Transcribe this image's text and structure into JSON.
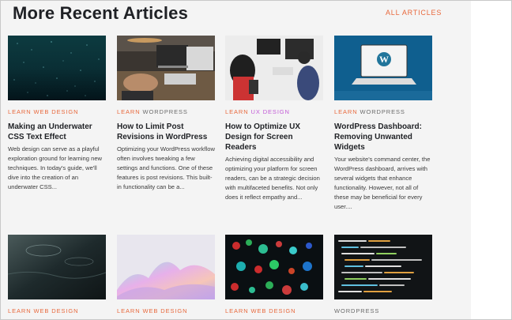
{
  "header": {
    "title": "More Recent Articles",
    "all_articles": "ALL ARTICLES"
  },
  "articles": [
    {
      "learn": "LEARN",
      "category": "WEB DESIGN",
      "title": "Making an Underwater CSS Text Effect",
      "excerpt": "Web design can serve as a playful exploration ground for learning new techniques. In today's guide, we'll dive into the creation of an underwater CSS..."
    },
    {
      "learn": "LEARN",
      "category": "WORDPRESS",
      "title": "How to Limit Post Revisions in WordPress",
      "excerpt": "Optimizing your WordPress workflow often involves tweaking a few settings and functions. One of these features is post revisions. This built-in functionality can be a..."
    },
    {
      "learn": "LEARN",
      "category": "UX DESIGN",
      "title": "How to Optimize UX Design for Screen Readers",
      "excerpt": "Achieving digital accessibility and optimizing your platform for screen readers, can be a strategic decision with multifaceted benefits. Not only does it reflect empathy and..."
    },
    {
      "learn": "LEARN",
      "category": "WORDPRESS",
      "title": "WordPress Dashboard: Removing Unwanted Widgets",
      "excerpt": "Your website's command center, the WordPress dashboard, arrives with several widgets that enhance functionality. However, not all of these may be beneficial for every user...."
    },
    {
      "learn": "LEARN",
      "category": "WEB DESIGN"
    },
    {
      "learn": "LEARN",
      "category": "WEB DESIGN"
    },
    {
      "learn": "LEARN",
      "category": "WEB DESIGN"
    },
    {
      "learn": "",
      "category": "WORDPRESS"
    }
  ]
}
